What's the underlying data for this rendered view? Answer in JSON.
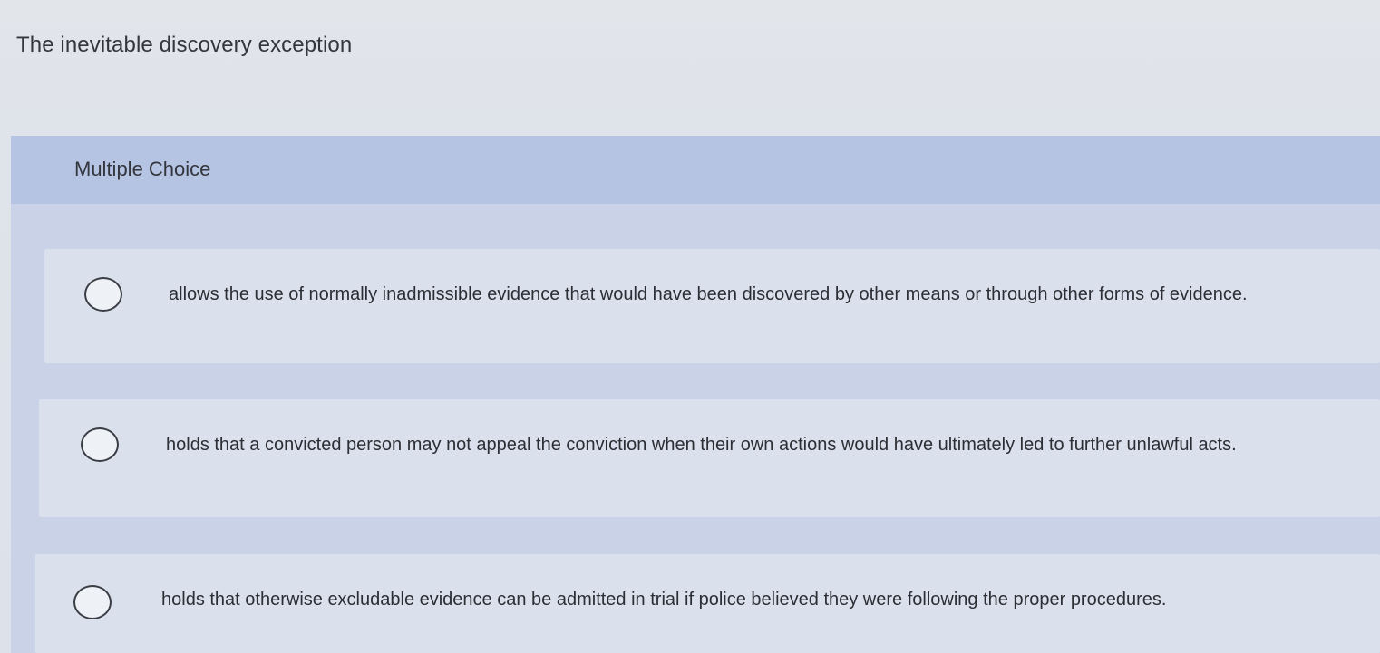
{
  "question": {
    "stem": "The inevitable discovery exception",
    "type_label": "Multiple Choice",
    "options": [
      {
        "text": "allows the use of normally inadmissible evidence that would have been discovered by other means or through other forms of evidence."
      },
      {
        "text": "holds that a convicted person may not appeal the conviction when their own actions would have ultimately led to further unlawful acts."
      },
      {
        "text": "holds that otherwise excludable evidence can be admitted in trial if police believed they were following the proper procedures."
      }
    ]
  },
  "colors": {
    "header_band": "#b6c4e4",
    "option_background": "#dbe1ec",
    "page_background": "#e2e5ea"
  },
  "icons": {
    "radio": "radio-button-unselected-icon"
  }
}
